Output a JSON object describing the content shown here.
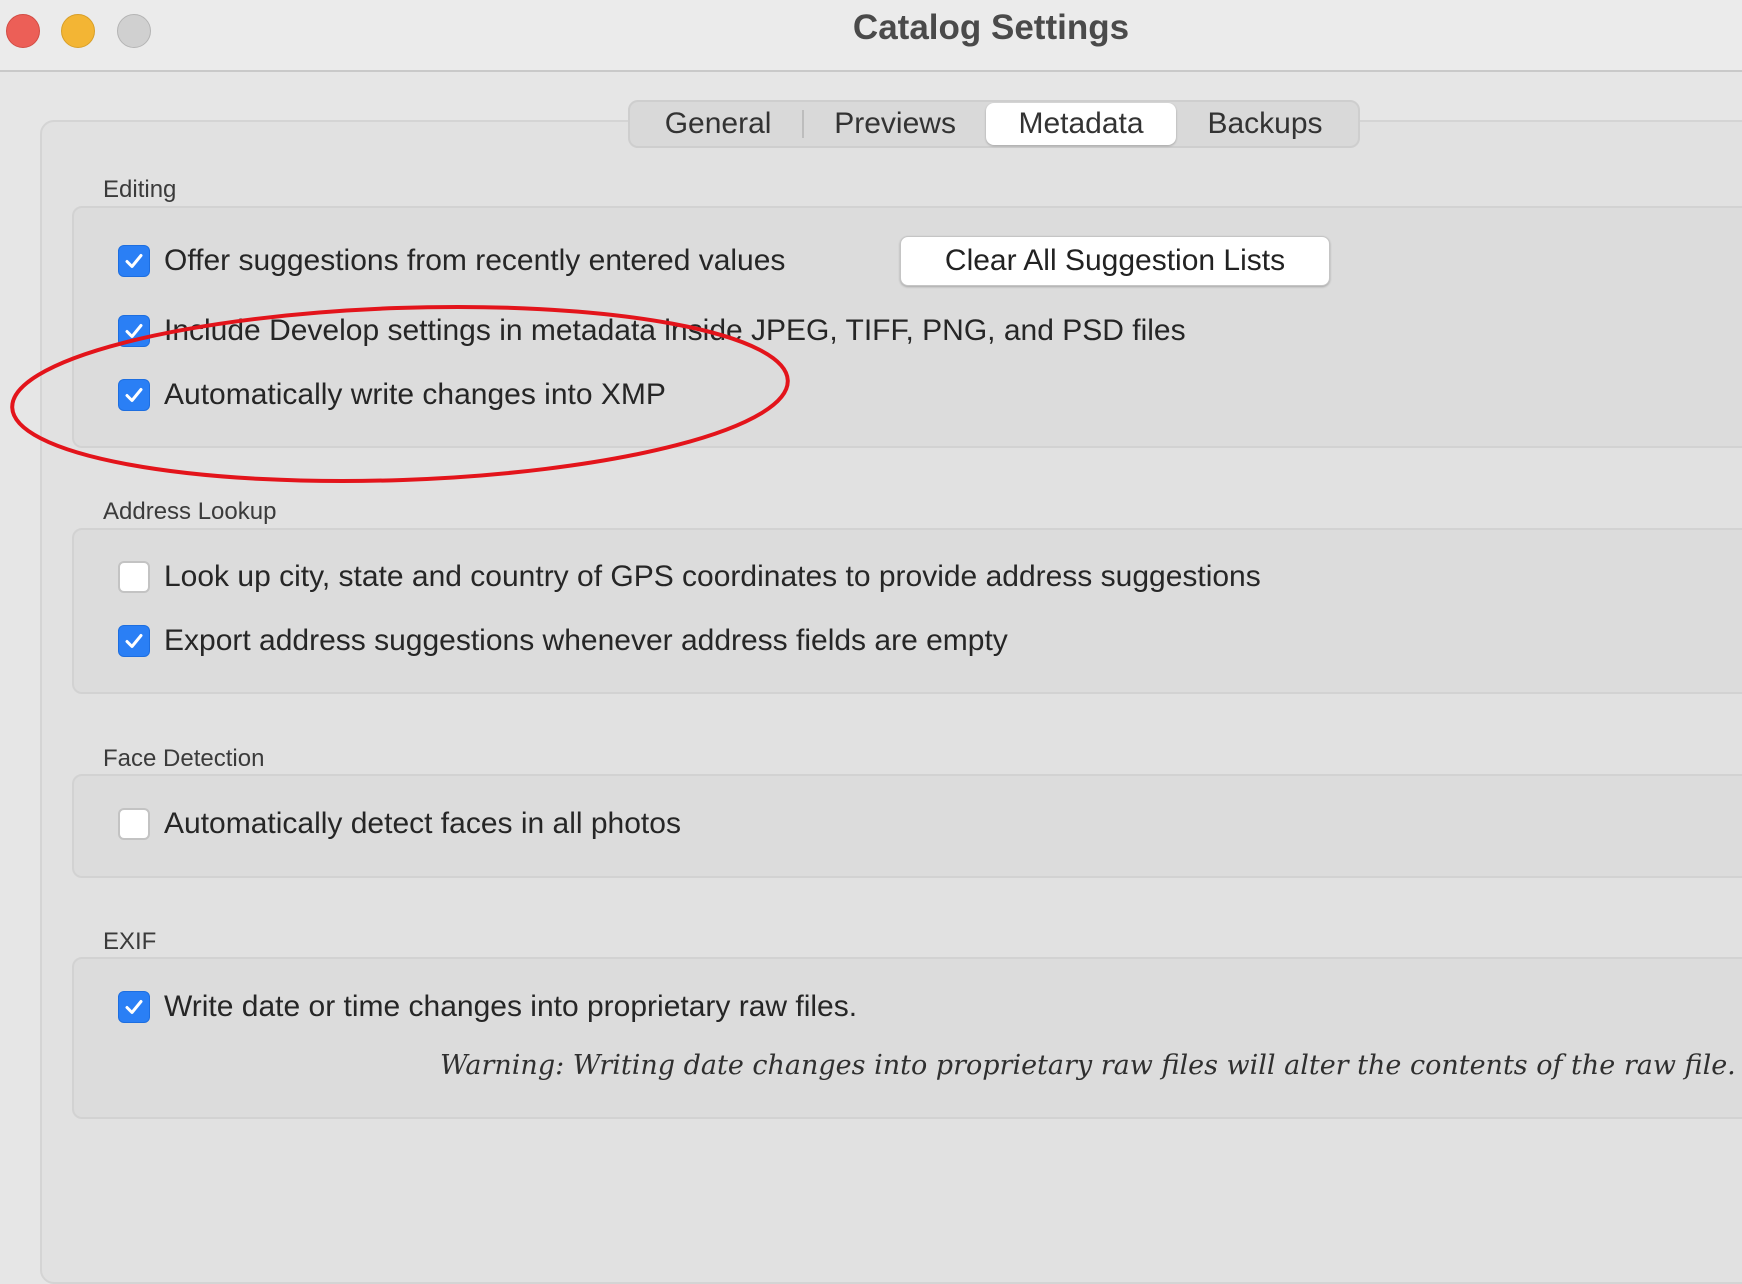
{
  "window": {
    "title": "Catalog Settings"
  },
  "tabs": [
    {
      "label": "General",
      "selected": false
    },
    {
      "label": "Previews",
      "selected": false
    },
    {
      "label": "Metadata",
      "selected": true
    },
    {
      "label": "Backups",
      "selected": false
    }
  ],
  "editing": {
    "label": "Editing",
    "offer_suggestions": {
      "label": "Offer suggestions from recently entered values",
      "checked": true
    },
    "clear_button": "Clear All Suggestion Lists",
    "include_develop": {
      "label": "Include Develop settings in metadata inside JPEG, TIFF, PNG, and PSD files",
      "checked": true
    },
    "auto_write_xmp": {
      "label": "Automatically write changes into XMP",
      "checked": true
    }
  },
  "address_lookup": {
    "label": "Address Lookup",
    "lookup_gps": {
      "label": "Look up city, state and country of GPS coordinates to provide address suggestions",
      "checked": false
    },
    "export_suggestions": {
      "label": "Export address suggestions whenever address fields are empty",
      "checked": true
    }
  },
  "face_detection": {
    "label": "Face Detection",
    "auto_detect": {
      "label": "Automatically detect faces in all photos",
      "checked": false
    }
  },
  "exif": {
    "label": "EXIF",
    "write_date": {
      "label": "Write date or time changes into proprietary raw files.",
      "checked": true
    },
    "warning": "Warning: Writing date changes into proprietary raw files will alter the contents of the raw file."
  },
  "colors": {
    "checkbox_accent": "#2a7ff5",
    "annotation_ellipse": "#e3141b"
  },
  "icons": [
    "close-button",
    "minimize-button",
    "zoom-button",
    "checkmark-icon"
  ]
}
